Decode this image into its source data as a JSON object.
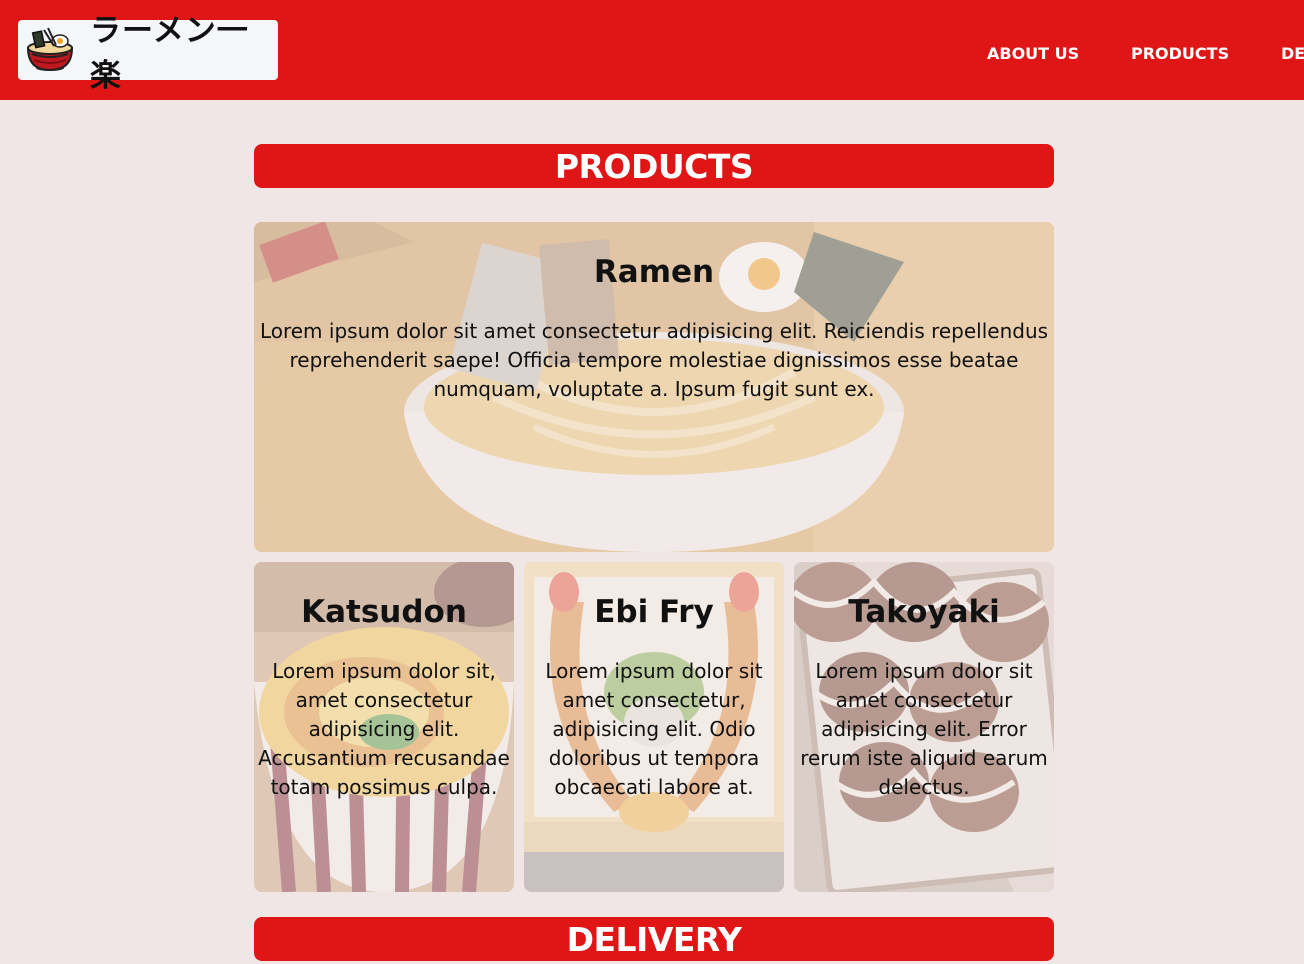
{
  "header": {
    "logo_text": "ラーメン一楽",
    "logo_icon": "ramen-bowl-icon",
    "brand_color": "#e01515",
    "nav": [
      {
        "label": "ABOUT US"
      },
      {
        "label": "PRODUCTS"
      },
      {
        "label": "DELIVERY"
      }
    ]
  },
  "products": {
    "heading": "PRODUCTS",
    "featured": {
      "title": "Ramen",
      "text": "Lorem ipsum dolor sit amet consectetur adipisicing elit. Reiciendis repellendus reprehenderit saepe! Officia tempore molestiae dignissimos esse beatae numquam, voluptate a. Ipsum fugit sunt ex."
    },
    "items": [
      {
        "title": "Katsudon",
        "text": "Lorem ipsum dolor sit, amet consectetur adipisicing elit. Accusantium recusandae totam possimus culpa."
      },
      {
        "title": "Ebi Fry",
        "text": "Lorem ipsum dolor sit amet consectetur, adipisicing elit. Odio doloribus ut tempora obcaecati labore at."
      },
      {
        "title": "Takoyaki",
        "text": "Lorem ipsum dolor sit amet consectetur adipisicing elit. Error rerum iste aliquid earum delectus."
      }
    ]
  },
  "delivery": {
    "heading": "DELIVERY"
  }
}
